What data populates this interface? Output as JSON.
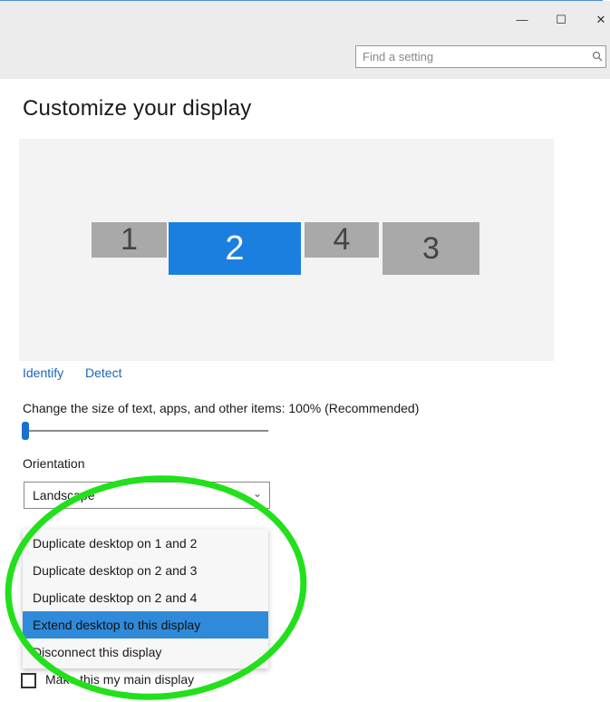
{
  "window": {
    "minimize": "—",
    "maximize": "☐",
    "close": "✕"
  },
  "search": {
    "placeholder": "Find a setting",
    "icon": "search-icon"
  },
  "page": {
    "title": "Customize your display"
  },
  "monitors": [
    {
      "label": "1",
      "selected": false
    },
    {
      "label": "2",
      "selected": true
    },
    {
      "label": "4",
      "selected": false
    },
    {
      "label": "3",
      "selected": false
    }
  ],
  "links": {
    "identify": "Identify",
    "detect": "Detect"
  },
  "scale": {
    "label": "Change the size of text, apps, and other items: 100% (Recommended)",
    "value_fraction": 0.0
  },
  "orientation": {
    "label": "Orientation",
    "value": "Landscape"
  },
  "multiple_displays": {
    "options": [
      "Duplicate desktop on 1 and 2",
      "Duplicate desktop on 2 and 3",
      "Duplicate desktop on 2 and 4",
      "Extend desktop to this display",
      "Disconnect this display"
    ],
    "selected_index": 3
  },
  "main_display": {
    "label": "Make this my main display",
    "checked": false
  },
  "colors": {
    "accent": "#1b7fe0",
    "selection": "#2f8ad9",
    "annotation": "#22e01c"
  }
}
